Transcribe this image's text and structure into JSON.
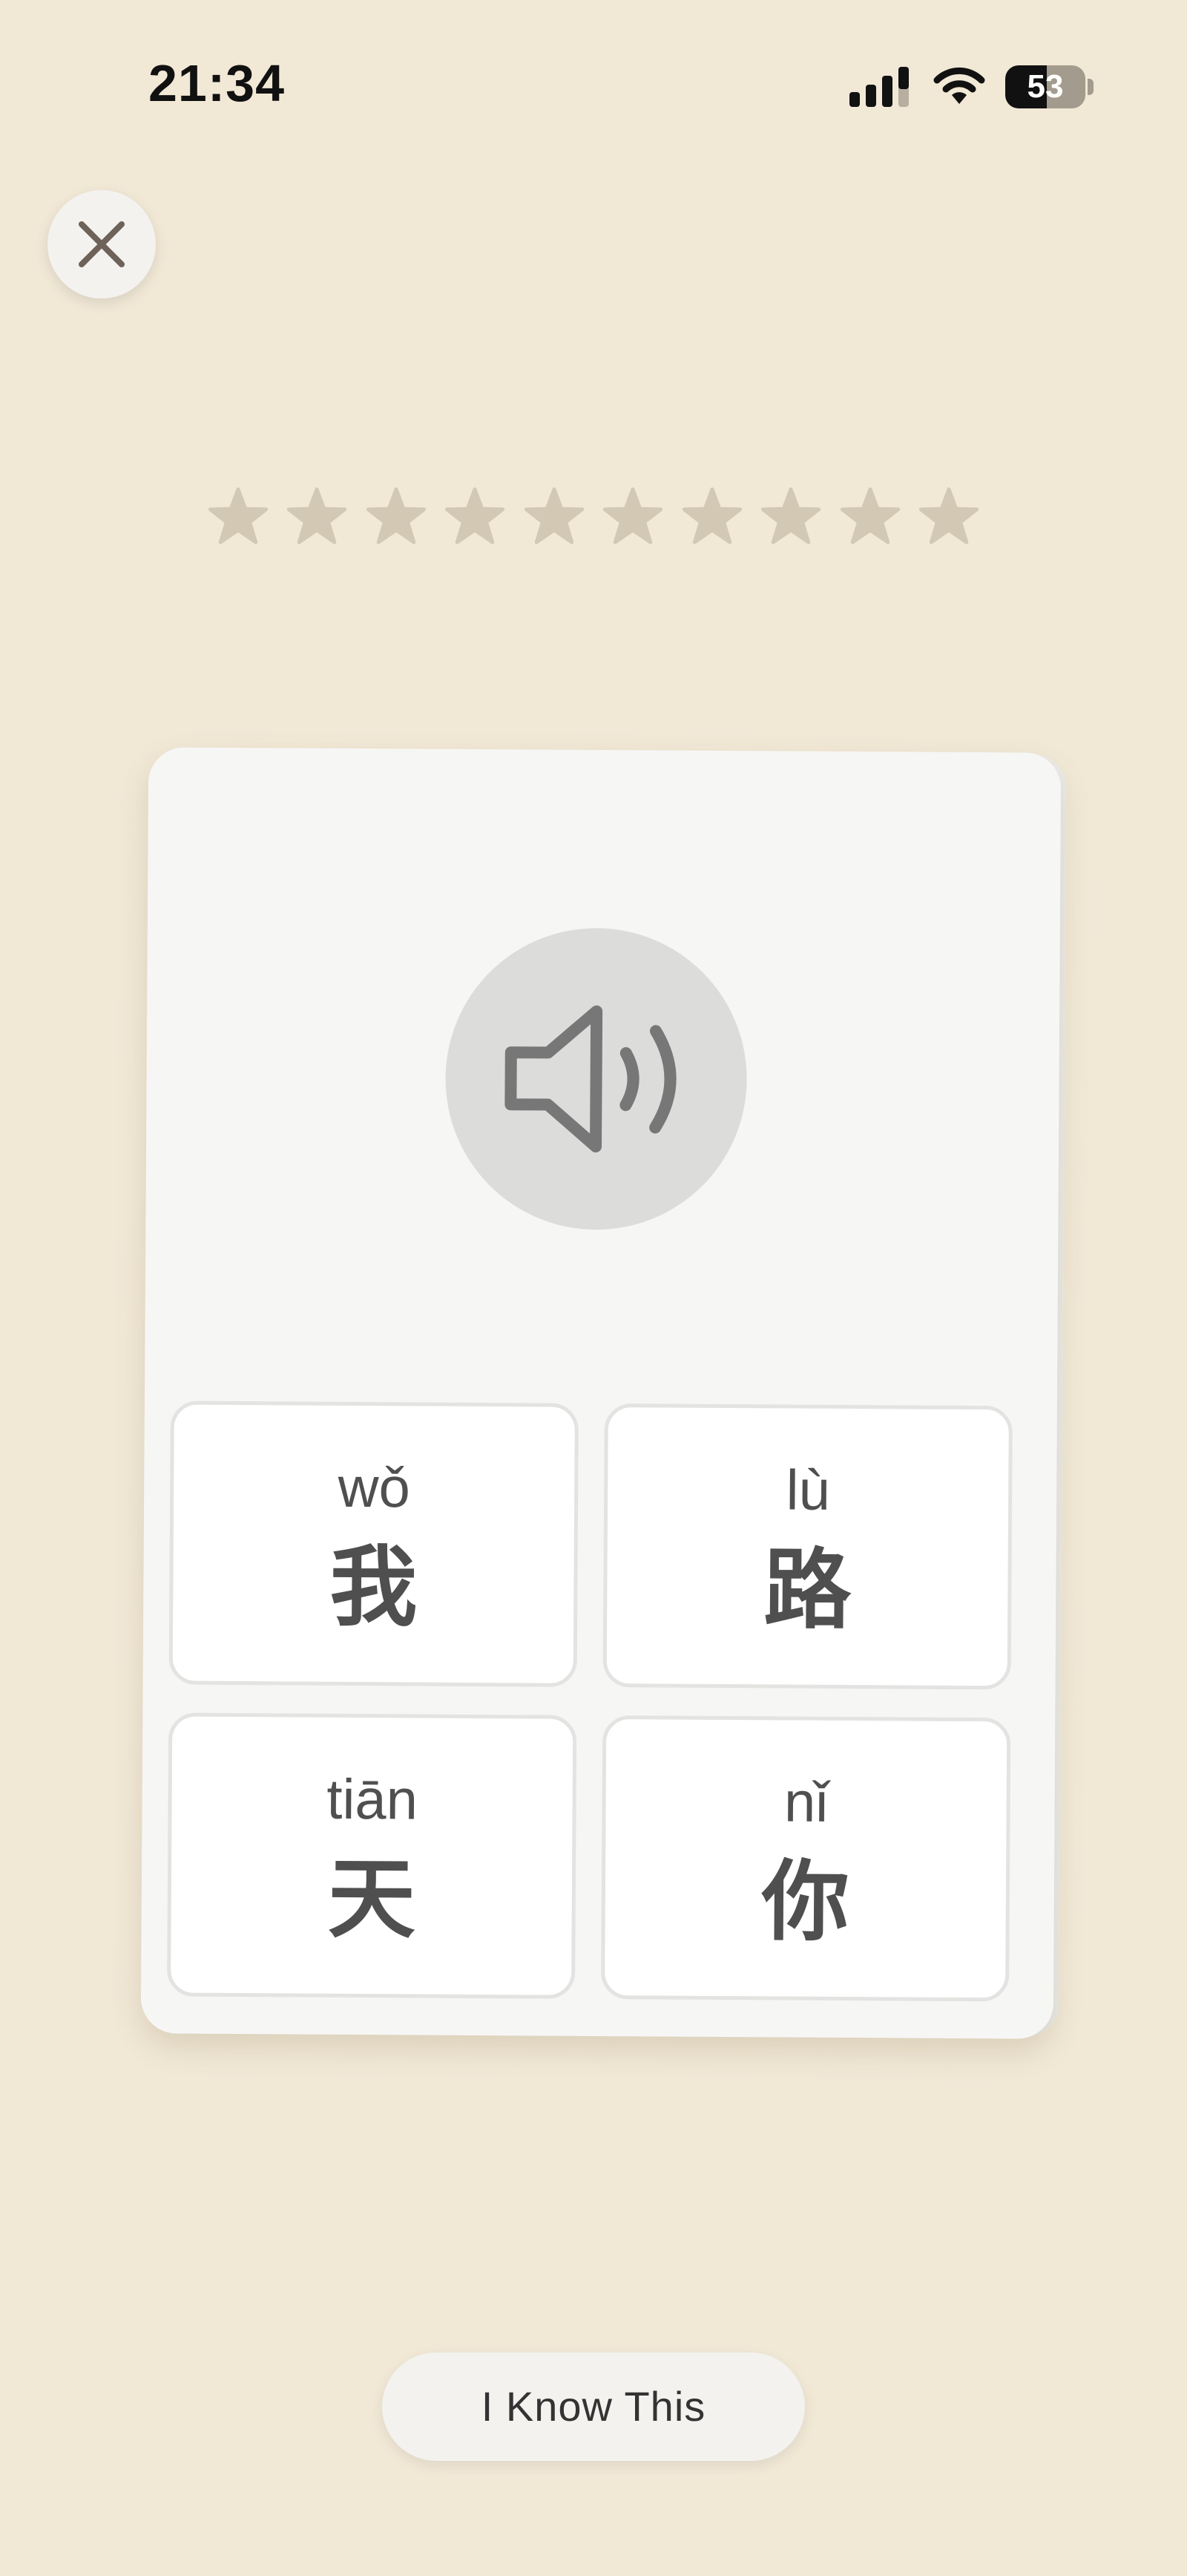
{
  "status_bar": {
    "time": "21:34",
    "battery_level": "53",
    "icons": [
      "signal-icon",
      "wifi-icon",
      "battery-icon"
    ]
  },
  "close_button": {
    "icon": "close-icon"
  },
  "progress": {
    "total_stars": 10,
    "filled_stars": 0,
    "star_color": "#d2c8b3"
  },
  "card": {
    "speaker_icon": "speaker-icon",
    "options": [
      {
        "pinyin": "wǒ",
        "hanzi": "我"
      },
      {
        "pinyin": "lù",
        "hanzi": "路"
      },
      {
        "pinyin": "tiān",
        "hanzi": "天"
      },
      {
        "pinyin": "nǐ",
        "hanzi": "你"
      }
    ]
  },
  "footer": {
    "know_label": "I Know This"
  },
  "colors": {
    "background": "#f1e8d6",
    "card": "#f6f6f5",
    "text": "#4f4f4f"
  }
}
